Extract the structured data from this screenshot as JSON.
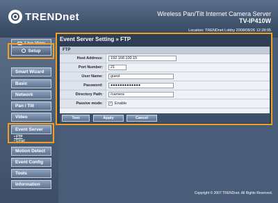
{
  "header": {
    "logo": "TRENDnet",
    "product_line1": "Wireless Pan/Tilt Internet Camera Server",
    "product_line2": "TV-IP410W",
    "location": "Location: TRENDnet Lobby   2008/08/26 12:28:05"
  },
  "sidebar": {
    "top": [
      {
        "label": "Live View",
        "icon": "camera-icon"
      },
      {
        "label": "Setup",
        "icon": "gear-icon"
      }
    ],
    "items": [
      {
        "label": "Smart Wizard"
      },
      {
        "label": "Basic"
      },
      {
        "label": "Network"
      },
      {
        "label": "Pan / Tilt"
      },
      {
        "label": "Video"
      },
      {
        "label": "Event Server"
      },
      {
        "label": "Motion Detect"
      },
      {
        "label": "Event Config"
      },
      {
        "label": "Tools"
      },
      {
        "label": "Information"
      }
    ],
    "event_sub": [
      {
        "label": "• FTP"
      },
      {
        "label": "• Email"
      }
    ]
  },
  "panel": {
    "title": "Event Server Setting » FTP",
    "section": "FTP",
    "fields": [
      {
        "label": "Host Address:",
        "value": "192.168.100.15"
      },
      {
        "label": "Port Number:",
        "value": "21"
      },
      {
        "label": "User Name:",
        "value": "guest"
      },
      {
        "label": "Password:",
        "value": "●●●●●●●●●●●●●"
      },
      {
        "label": "Directory Path:",
        "value": "/camera"
      }
    ],
    "passive": {
      "label": "Passive mode:",
      "checkbox_label": "Enable",
      "checked": true,
      "mark": "✓"
    },
    "buttons": {
      "test": "Test",
      "apply": "Apply",
      "cancel": "Cancel"
    }
  },
  "footer": {
    "copyright": "Copyright © 2007 TRENDnet. All Rights Reserved."
  },
  "colors": {
    "highlight": "#f0a020",
    "header_bg": "#4a5d78",
    "panel_bg": "#2e3e55"
  }
}
